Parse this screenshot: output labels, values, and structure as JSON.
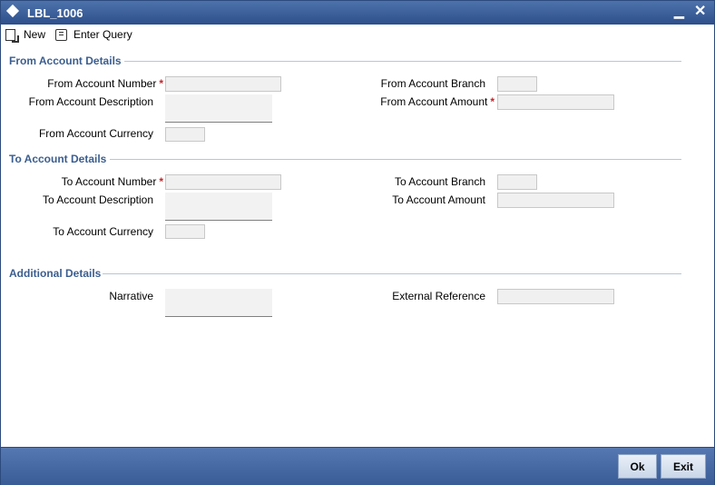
{
  "window": {
    "title": "LBL_1006",
    "minimize_glyph": "▁",
    "close_glyph": "✕"
  },
  "toolbar": {
    "new_label": "New",
    "enter_query_label": "Enter Query"
  },
  "from_section": {
    "title": "From Account Details",
    "account_number_label": "From Account Number",
    "account_description_label": "From Account Description",
    "account_currency_label": "From Account Currency",
    "account_branch_label": "From Account Branch",
    "account_amount_label": "From Account Amount"
  },
  "to_section": {
    "title": "To Account Details",
    "account_number_label": "To Account Number",
    "account_description_label": "To Account Description",
    "account_currency_label": "To Account Currency",
    "account_branch_label": "To Account Branch",
    "account_amount_label": "To Account Amount"
  },
  "additional_section": {
    "title": "Additional Details",
    "narrative_label": "Narrative",
    "external_reference_label": "External Reference"
  },
  "required_marker": "*",
  "footer": {
    "ok_label": "Ok",
    "exit_label": "Exit"
  }
}
